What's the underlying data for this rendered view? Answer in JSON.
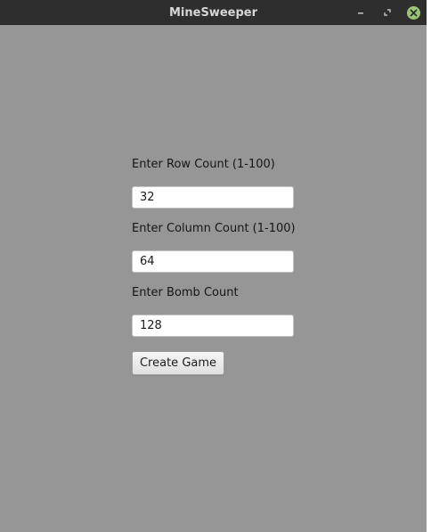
{
  "window": {
    "title": "MineSweeper",
    "controls": {
      "minimize_icon": "minimize-icon",
      "maximize_icon": "restore-icon",
      "close_icon": "close-icon"
    }
  },
  "form": {
    "rows": {
      "label": "Enter Row Count (1-100)",
      "value": "32"
    },
    "columns": {
      "label": "Enter Column Count (1-100)",
      "value": "64"
    },
    "bombs": {
      "label": "Enter Bomb Count",
      "value": "128"
    },
    "submit_label": "Create Game"
  },
  "colors": {
    "window_background": "#969696",
    "titlebar": "#2e2e2e",
    "close_button": "#9bc476"
  }
}
